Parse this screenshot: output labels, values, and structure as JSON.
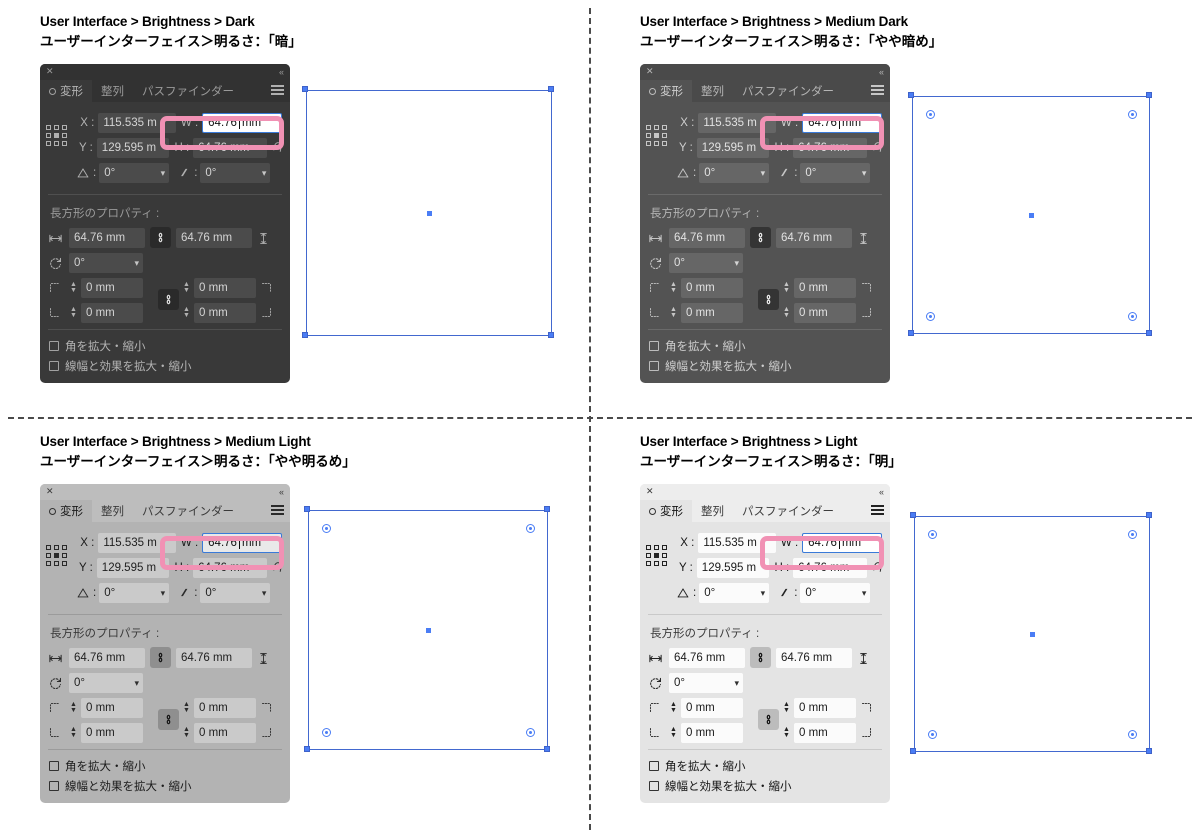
{
  "quadrants": [
    {
      "id": "dark",
      "caption_en": "User Interface > Brightness > Dark",
      "caption_ja": "ユーザーインターフェイス＞明るさ：「暗」",
      "theme": {
        "titlebar_bg": "#323232",
        "panel_bg": "#393939",
        "tabbar_bg": "#323232",
        "tab_active_bg": "#393939",
        "field_bg": "#4b4b4b",
        "field_text": "#d4d4d4",
        "label_text": "#b4b4b4",
        "muted_text": "#9a9a9a",
        "icon_color": "#b0b0b0",
        "link_bg": "#2a2a2a",
        "link_fg": "#e0e0e0",
        "divider": "#4f4f4f",
        "w_field_bg": "#ffffff",
        "w_field_text": "#111111",
        "w_field_border": "#3a7ad8"
      }
    },
    {
      "id": "medium-dark",
      "caption_en": "User Interface > Brightness > Medium Dark",
      "caption_ja": "ユーザーインターフェイス＞明るさ：「やや暗め」",
      "theme": {
        "titlebar_bg": "#4a4a4a",
        "panel_bg": "#535353",
        "tabbar_bg": "#4a4a4a",
        "tab_active_bg": "#535353",
        "field_bg": "#666666",
        "field_text": "#e2e2e2",
        "label_text": "#cfcfcf",
        "muted_text": "#b5b5b5",
        "icon_color": "#c6c6c6",
        "link_bg": "#343434",
        "link_fg": "#ededed",
        "divider": "#6a6a6a",
        "w_field_bg": "#ffffff",
        "w_field_text": "#111111",
        "w_field_border": "#3a7ad8"
      }
    },
    {
      "id": "medium-light",
      "caption_en": "User Interface > Brightness > Medium Light",
      "caption_ja": "ユーザーインターフェイス＞明るさ：「やや明るめ」",
      "theme": {
        "titlebar_bg": "#bdbdbd",
        "panel_bg": "#b3b3b3",
        "tabbar_bg": "#bdbdbd",
        "tab_active_bg": "#b3b3b3",
        "field_bg": "#cacaca",
        "field_text": "#1e1e1e",
        "label_text": "#1a1a1a",
        "muted_text": "#3a3a3a",
        "icon_color": "#2a2a2a",
        "link_bg": "#8f8f8f",
        "link_fg": "#141414",
        "divider": "#9b9b9b",
        "w_field_bg": "#e9e9e9",
        "w_field_text": "#111111",
        "w_field_border": "#3a7ad8"
      }
    },
    {
      "id": "light",
      "caption_en": "User Interface > Brightness > Light",
      "caption_ja": "ユーザーインターフェイス＞明るさ：「明」",
      "theme": {
        "titlebar_bg": "#ededed",
        "panel_bg": "#e4e4e4",
        "tabbar_bg": "#ededed",
        "tab_active_bg": "#e4e4e4",
        "field_bg": "#fbfbfb",
        "field_text": "#1a1a1a",
        "label_text": "#141414",
        "muted_text": "#3c3c3c",
        "icon_color": "#222222",
        "link_bg": "#bcbcbc",
        "link_fg": "#101010",
        "divider": "#c9c9c9",
        "w_field_bg": "#ffffff",
        "w_field_text": "#111111",
        "w_field_border": "#3a7ad8"
      }
    }
  ],
  "panel": {
    "close_glyph": "✕",
    "collapse_glyph": "«",
    "tabs": [
      {
        "label": "変形",
        "active": true
      },
      {
        "label": "整列",
        "active": false
      },
      {
        "label": "パスファインダー",
        "active": false
      }
    ],
    "menu_icon": "hamburger-icon",
    "transform": {
      "x_label": "X :",
      "x_value": "115.535 m",
      "y_label": "Y :",
      "y_value": "129.595 m",
      "w_label": "W :",
      "w_value": "64.76",
      "w_unit": "mm",
      "h_label": "H :",
      "h_value": "64.76 mm",
      "shear_label": "⊿:",
      "shear_value": "0°",
      "slant_value": "0°",
      "reference_point": "center"
    },
    "rect_props": {
      "title": "長方形のプロパティ :",
      "width_value": "64.76 mm",
      "height_value": "64.76 mm",
      "rotation_value": "0°",
      "corner_tl": "0 mm",
      "corner_tr": "0 mm",
      "corner_bl": "0 mm",
      "corner_br": "0 mm",
      "link_glyph": "🔗",
      "checkbox_1": "角を拡大・縮小",
      "checkbox_2": "線幅と効果を拡大・縮小"
    }
  },
  "accent": {
    "highlight_pink": "#f191b4",
    "selection_blue": "#4a7df5",
    "artwork_stroke": "#4268cf"
  }
}
